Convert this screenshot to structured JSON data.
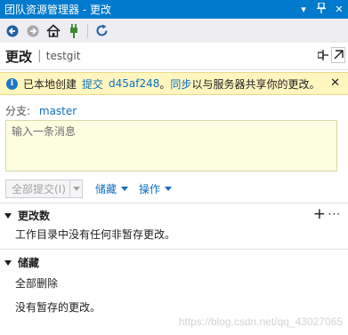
{
  "titlebar": {
    "title": "团队资源管理器 - 更改",
    "dropdown_glyph": "▾",
    "pin_glyph": "ᛘ",
    "close_glyph": "✕"
  },
  "header": {
    "title": "更改",
    "separator": "|",
    "repo": "testgit"
  },
  "info_bar": {
    "prefix": "已本地创建",
    "commit_word": "提交",
    "commit_id": "d45af248",
    "sync_word": "同步",
    "suffix": "以与服务器共享你的更改。",
    "close_glyph": "✕"
  },
  "branch": {
    "label": "分支:",
    "name": "master"
  },
  "commit_message": {
    "placeholder": "输入一条消息"
  },
  "actions": {
    "commit_all": "全部提交(I)",
    "stash": "储藏",
    "actions": "操作"
  },
  "changes_section": {
    "title": "更改数",
    "add_glyph": "+",
    "more_glyph": "···",
    "empty_text": "工作目录中没有任何非暂存更改。"
  },
  "stashes_section": {
    "title": "储藏",
    "delete_all": "全部删除",
    "empty_text": "没有暂存的更改。"
  },
  "watermark": "https://blog.csdn.net/qq_43027065",
  "colors": {
    "titlebar": "#007acc",
    "info_bar": "#fff6bf",
    "link": "#0e70c0",
    "message_box": "#fdfde1"
  }
}
